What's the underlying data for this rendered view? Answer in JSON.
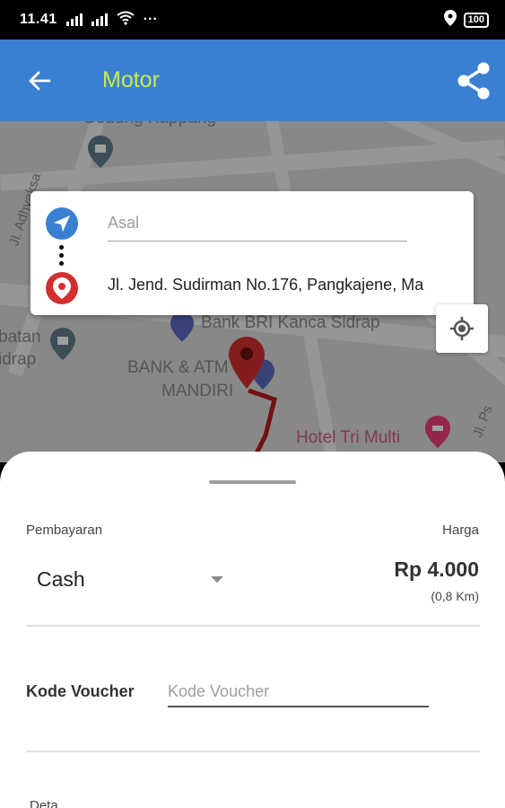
{
  "status_bar": {
    "time": "11.41",
    "overflow": "···",
    "battery": "100"
  },
  "toolbar": {
    "title": "Motor",
    "title_color": "#cde84a",
    "background": "#3a80d2",
    "back_icon": "arrow-left-icon",
    "share_icon": "share-icon"
  },
  "map": {
    "labels": {
      "top": "Gedung Kappang",
      "street_left": "Jl. Adhyaksa",
      "bank_bri": "Bank BRI Kanca Sidrap",
      "left_edge_1": "batan",
      "left_edge_2": "idrap",
      "bank_mandiri_1": "BANK & ATM",
      "bank_mandiri_2": "MANDIRI",
      "hotel": "Hotel Tri Multi",
      "street_right": "Jl. Ps"
    }
  },
  "location": {
    "origin_placeholder": "Asal",
    "destination": "Jl. Jend. Sudirman No.176, Pangkajene, Ma"
  },
  "sheet": {
    "payment_label": "Pembayaran",
    "payment_value": "Cash",
    "price_label": "Harga",
    "price": "Rp 4.000",
    "distance": "(0,8 Km)",
    "voucher_label": "Kode Voucher",
    "voucher_placeholder": "Kode Voucher",
    "next_label": "Deta"
  }
}
